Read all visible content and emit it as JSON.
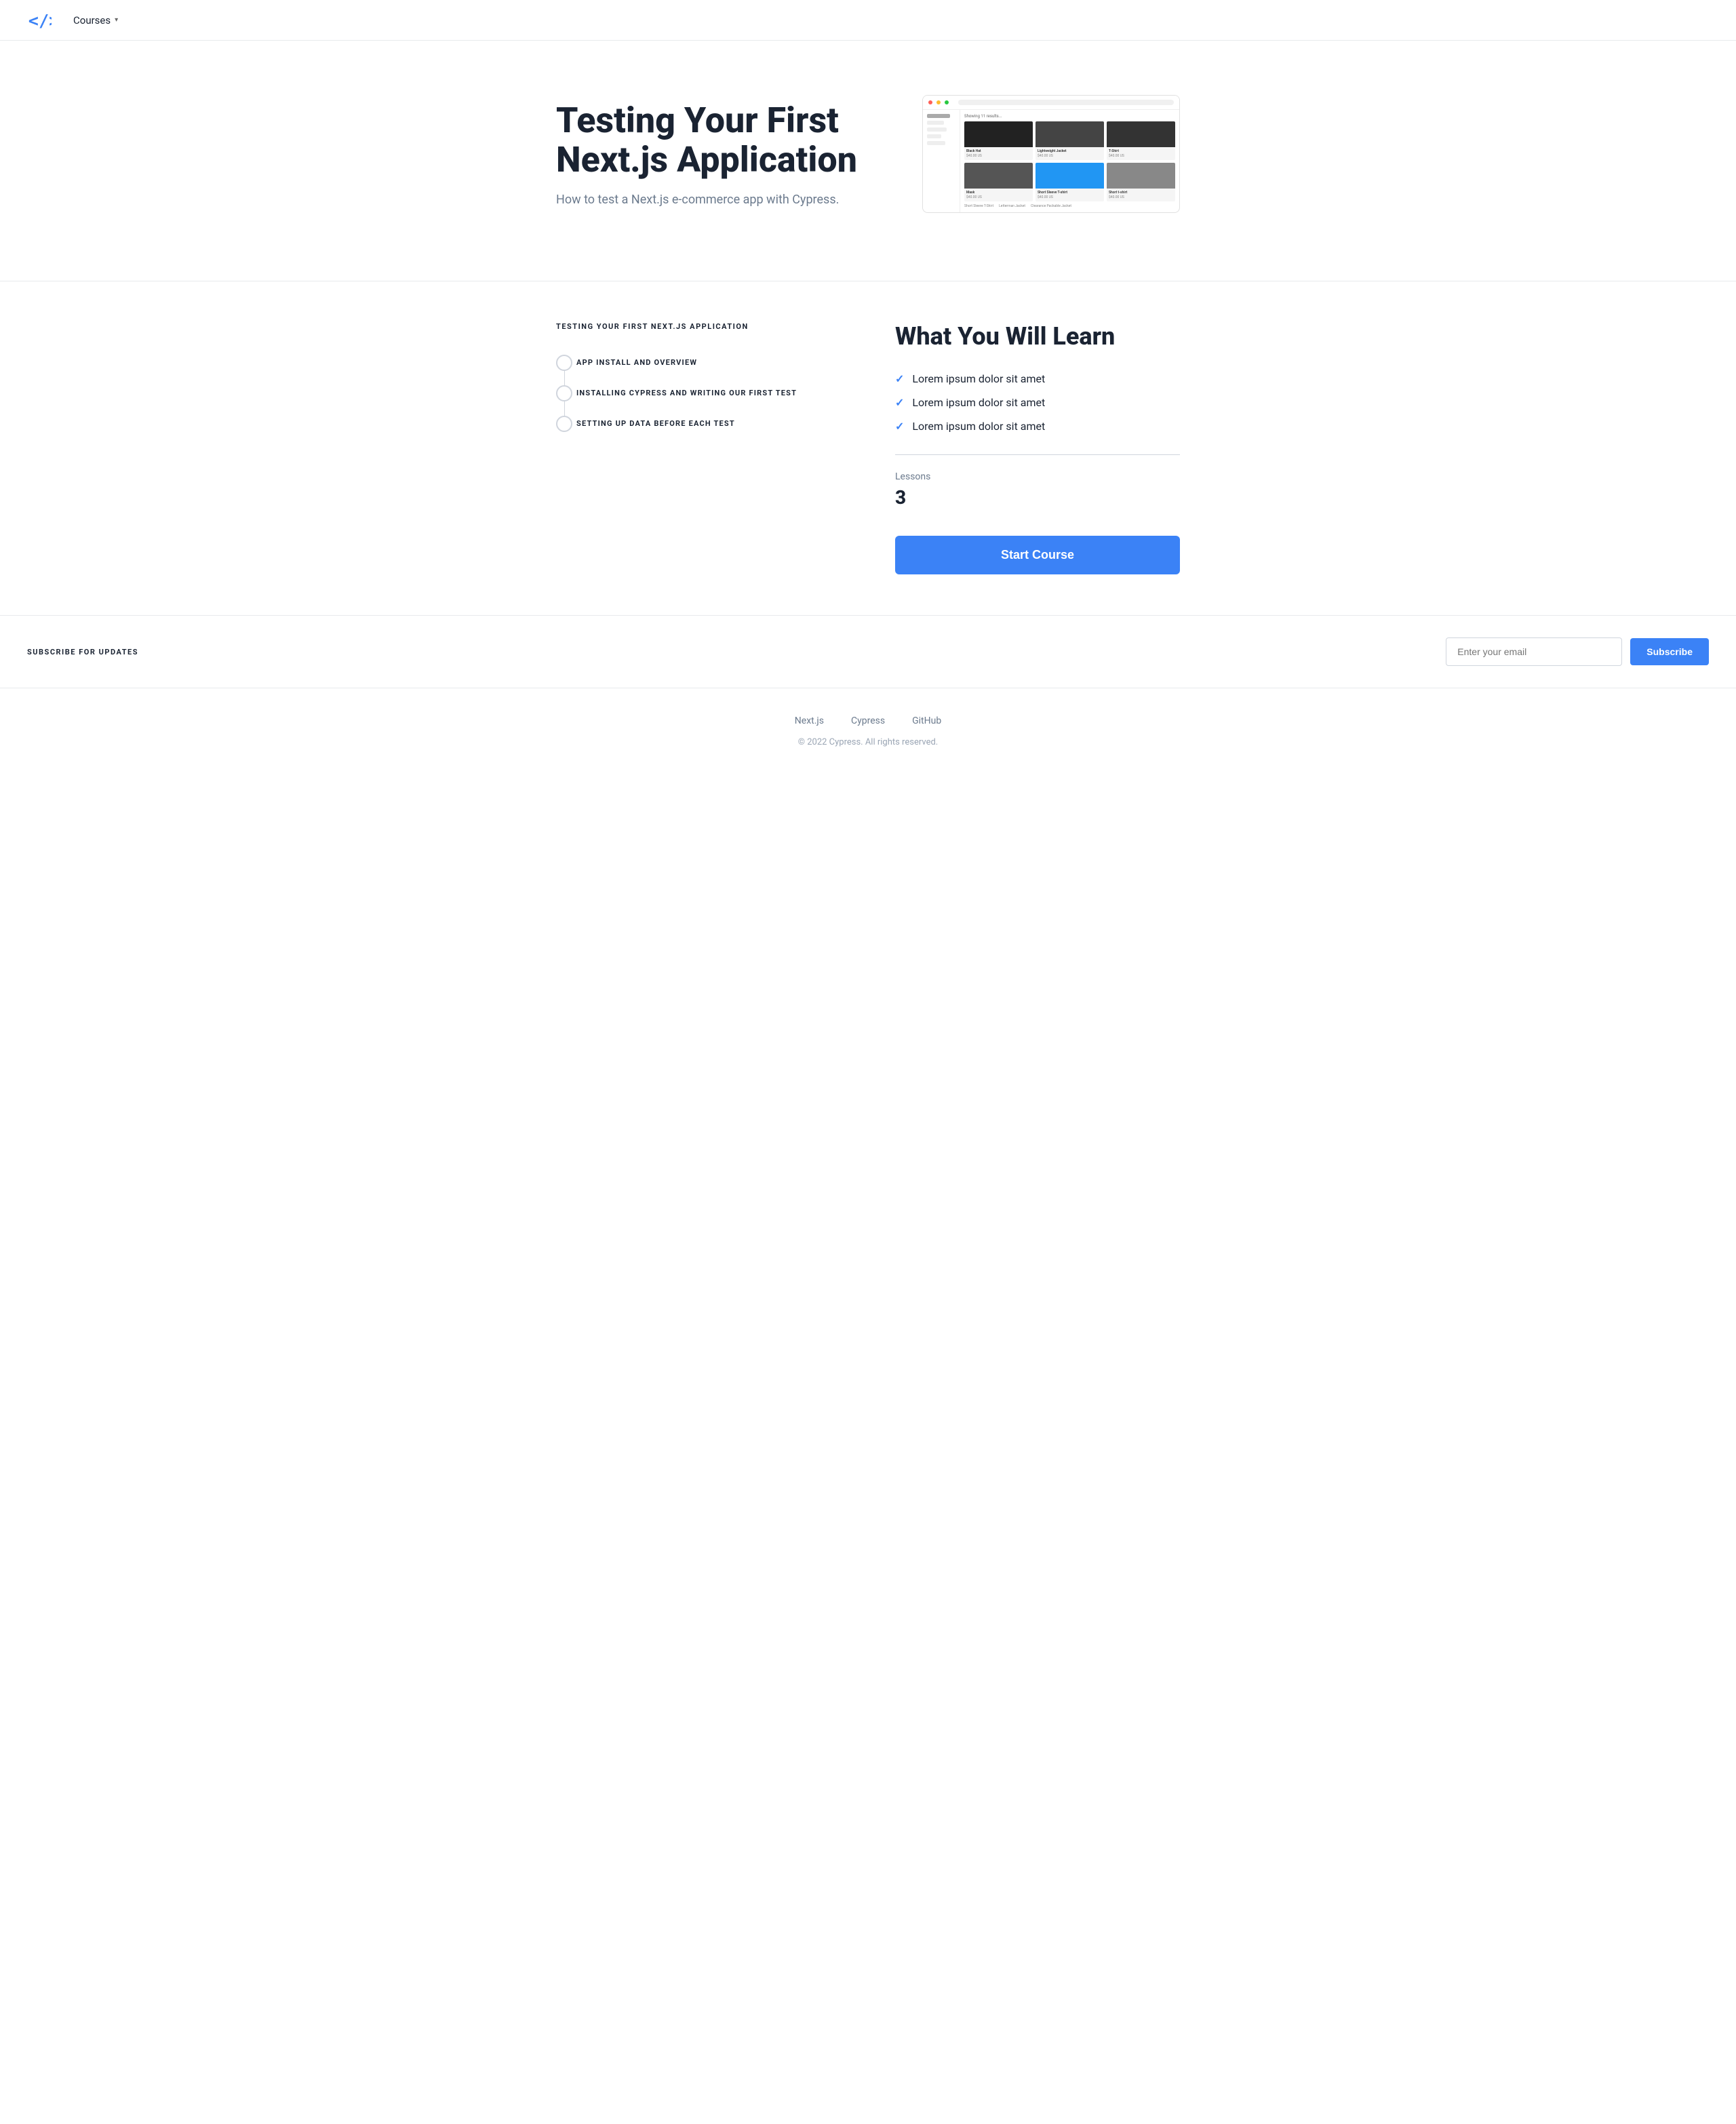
{
  "nav": {
    "logo_label": "</> ",
    "courses_label": "Courses",
    "chevron": "▾"
  },
  "hero": {
    "title": "Testing Your First Next.js Application",
    "subtitle": "How to test a Next.js e-commerce app with Cypress."
  },
  "curriculum": {
    "section_title": "TESTING YOUR FIRST NEXT.JS APPLICATION",
    "lessons": [
      {
        "label": "APP INSTALL AND OVERVIEW"
      },
      {
        "label": "INSTALLING CYPRESS AND WRITING OUR FIRST TEST"
      },
      {
        "label": "SETTING UP DATA BEFORE EACH TEST"
      }
    ]
  },
  "learn": {
    "title": "What You Will Learn",
    "items": [
      "Lorem ipsum dolor sit amet",
      "Lorem ipsum dolor sit amet",
      "Lorem ipsum dolor sit amet"
    ],
    "lessons_label": "Lessons",
    "lessons_count": "3",
    "start_button": "Start Course"
  },
  "subscribe": {
    "label": "SUBSCRIBE FOR UPDATES",
    "input_placeholder": "Enter your email",
    "button_label": "Subscribe"
  },
  "footer": {
    "links": [
      {
        "label": "Next.js",
        "href": "#"
      },
      {
        "label": "Cypress",
        "href": "#"
      },
      {
        "label": "GitHub",
        "href": "#"
      }
    ],
    "copyright": "© 2022 Cypress. All rights reserved."
  }
}
